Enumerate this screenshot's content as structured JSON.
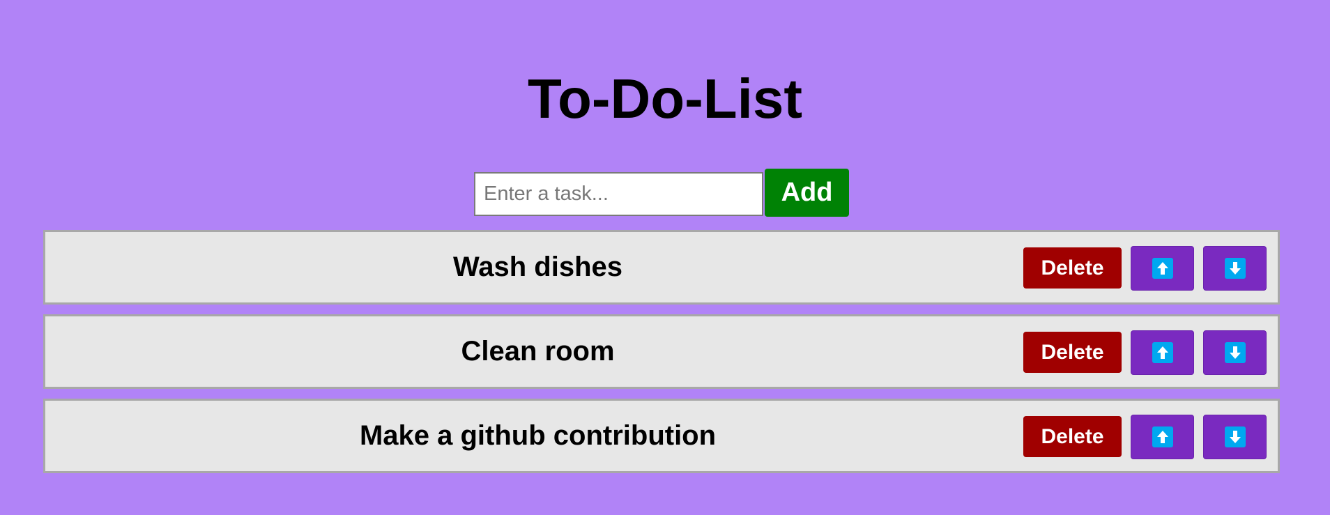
{
  "app": {
    "title": "To-Do-List"
  },
  "add_form": {
    "input_value": "",
    "input_placeholder": "Enter a task...",
    "add_label": "Add"
  },
  "tasks": [
    {
      "text": "Wash dishes",
      "delete_label": "Delete",
      "up_icon": "arrow-up-icon",
      "down_icon": "arrow-down-icon"
    },
    {
      "text": "Clean room",
      "delete_label": "Delete",
      "up_icon": "arrow-up-icon",
      "down_icon": "arrow-down-icon"
    },
    {
      "text": "Make a github contribution",
      "delete_label": "Delete",
      "up_icon": "arrow-up-icon",
      "down_icon": "arrow-down-icon"
    }
  ],
  "colors": {
    "background": "#b183f7",
    "add_button": "#008205",
    "delete_button": "#a00000",
    "move_button": "#7a2ac0",
    "arrow_icon": "#00a8f0",
    "row_background": "#e7e7e7"
  }
}
